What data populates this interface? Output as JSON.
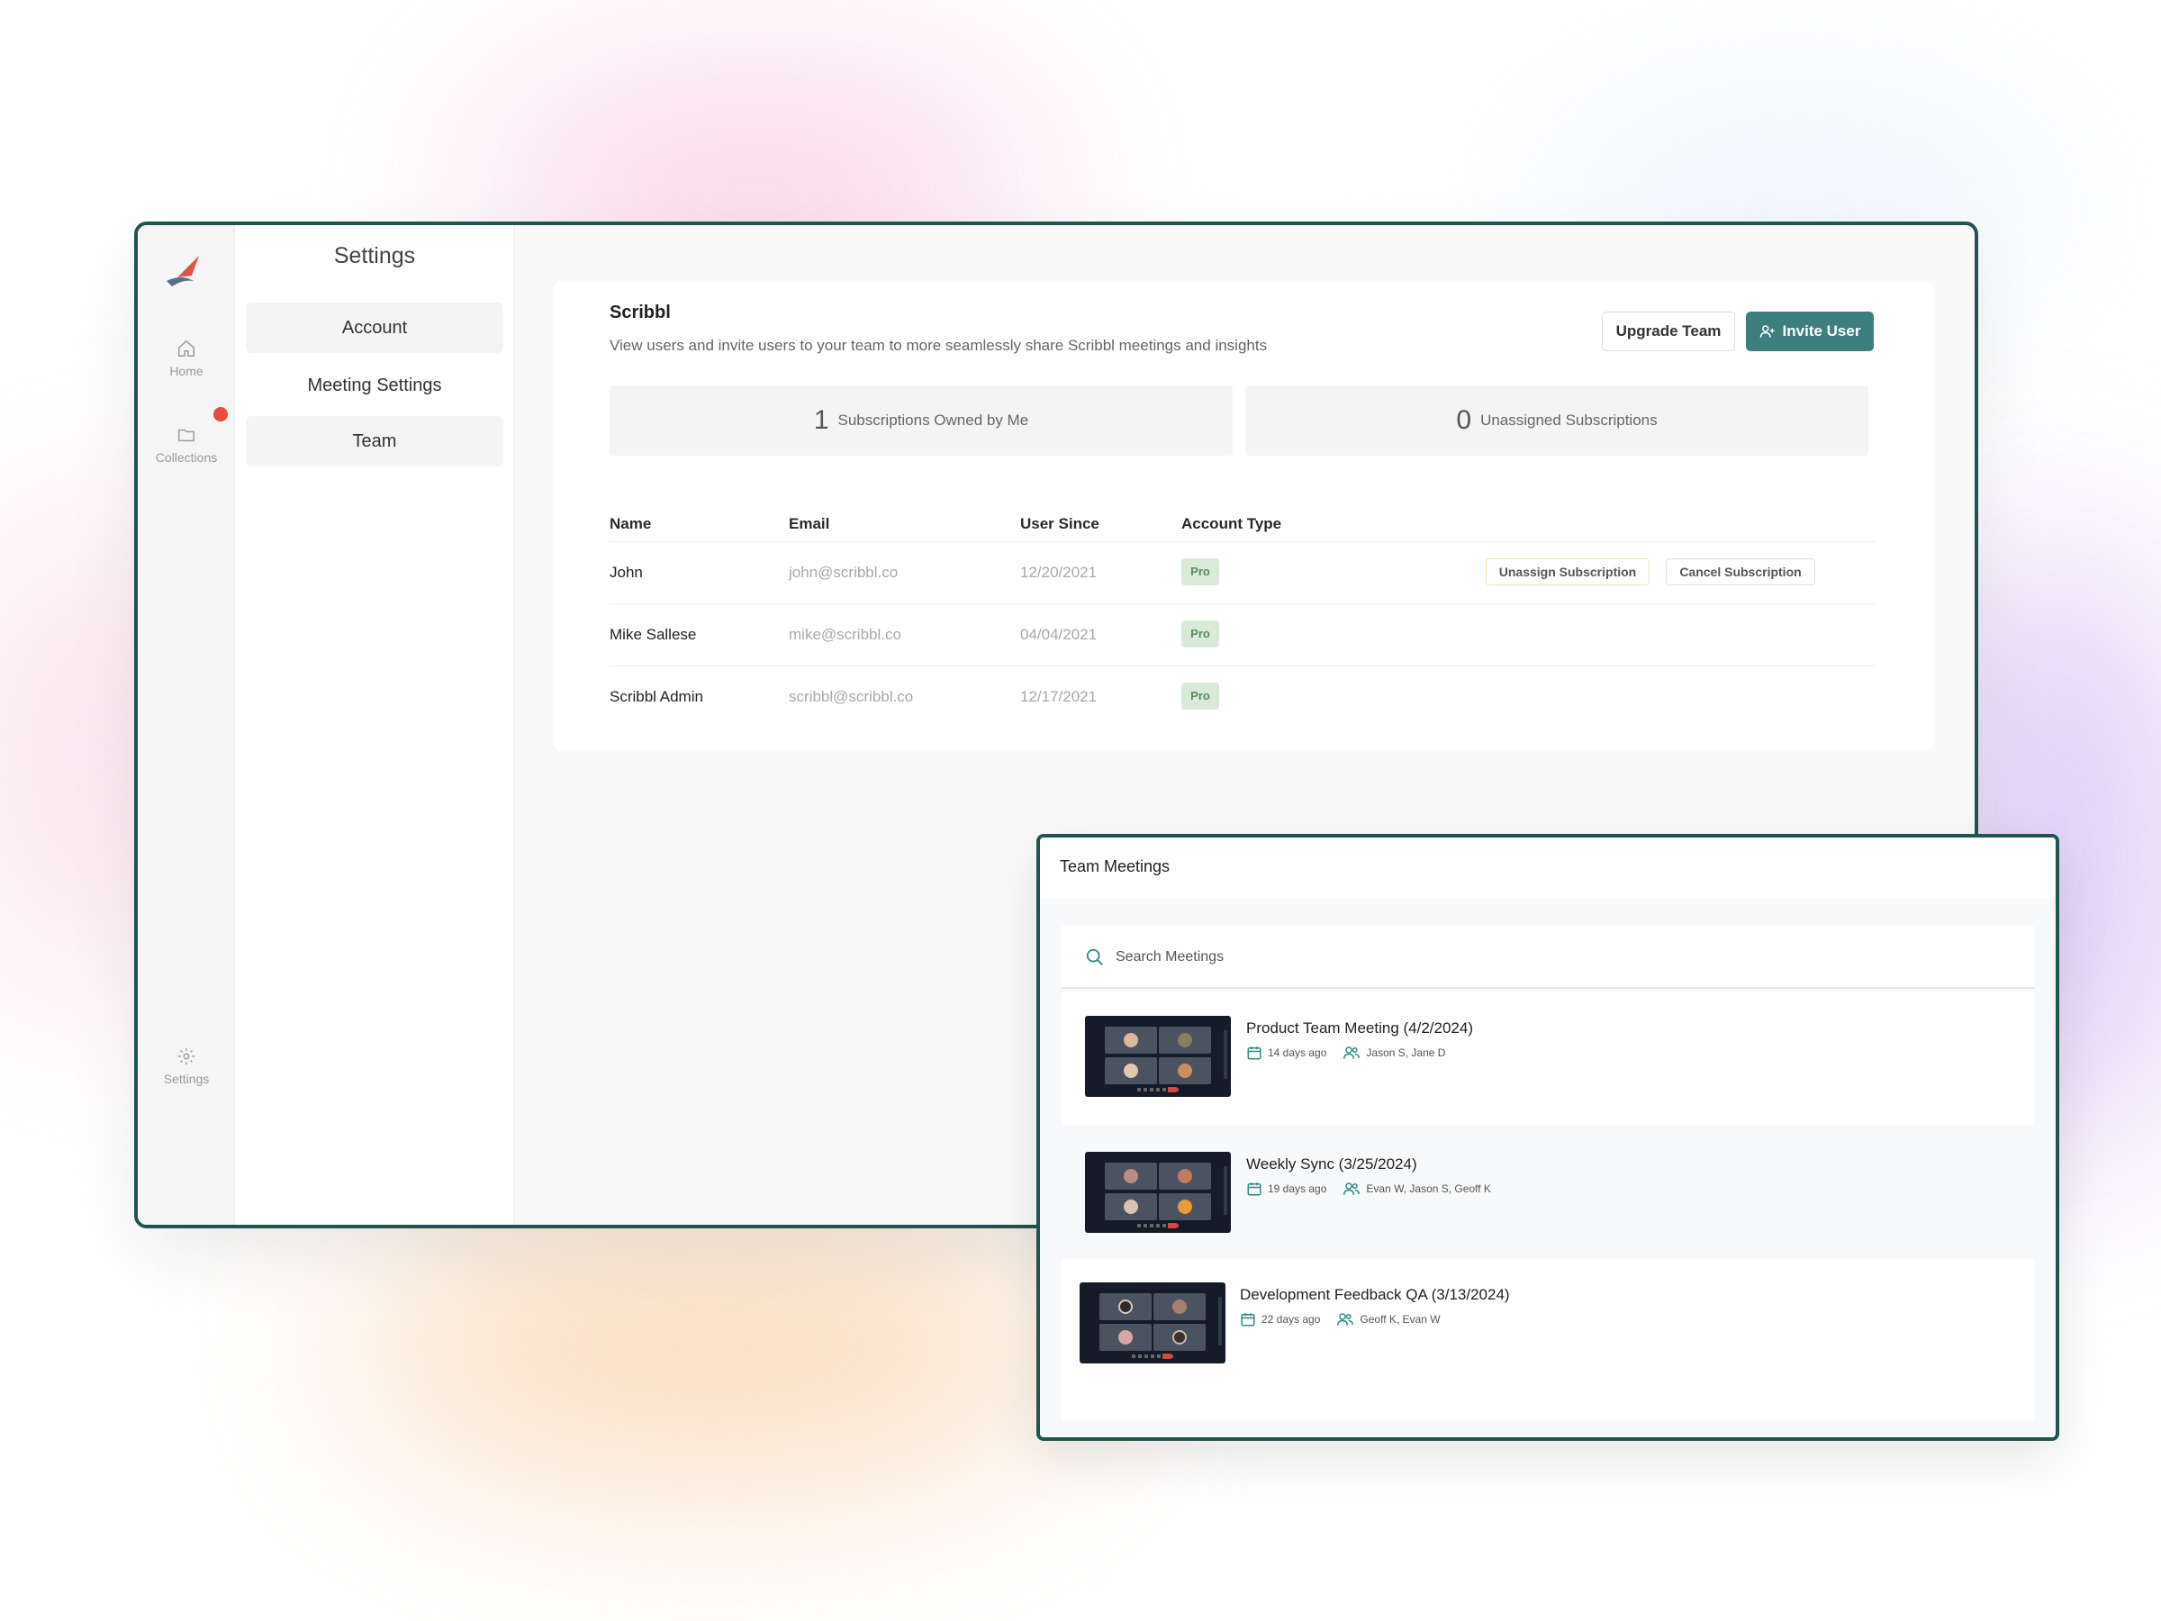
{
  "sidebar": {
    "items": [
      {
        "label": "Home",
        "icon": "home-icon"
      },
      {
        "label": "Collections",
        "icon": "folder-icon"
      },
      {
        "label": "Settings",
        "icon": "gear-icon"
      }
    ],
    "notification_color": "#e74c3c"
  },
  "settings_nav": {
    "title": "Settings",
    "items": [
      {
        "label": "Account"
      },
      {
        "label": "Meeting Settings"
      },
      {
        "label": "Team"
      }
    ]
  },
  "team": {
    "title": "Scribbl",
    "subtitle": "View users and invite users to your team to more seamlessly share Scribbl meetings and insights",
    "upgrade_label": "Upgrade Team",
    "invite_label": "Invite User",
    "stats": [
      {
        "count": "1",
        "label": "Subscriptions Owned by Me"
      },
      {
        "count": "0",
        "label": "Unassigned Subscriptions"
      }
    ],
    "columns": [
      "Name",
      "Email",
      "User Since",
      "Account Type"
    ],
    "rows": [
      {
        "name": "John",
        "email": "john@scribbl.co",
        "since": "12/20/2021",
        "type": "Pro"
      },
      {
        "name": "Mike Sallese",
        "email": "mike@scribbl.co",
        "since": "04/04/2021",
        "type": "Pro"
      },
      {
        "name": "Scribbl Admin",
        "email": "scribbl@scribbl.co",
        "since": "12/17/2021",
        "type": "Pro"
      }
    ],
    "row_actions": {
      "unassign_label": "Unassign Subscription",
      "cancel_label": "Cancel Subscription"
    },
    "accent_color": "#3c7f7d"
  },
  "team_meetings": {
    "title": "Team Meetings",
    "search_placeholder": "Search Meetings",
    "meetings": [
      {
        "title": "Product Team Meeting (4/2/2024)",
        "ago": "14 days ago",
        "participants": "Jason S, Jane D"
      },
      {
        "title": "Weekly Sync (3/25/2024)",
        "ago": "19 days ago",
        "participants": "Evan W, Jason S, Geoff K"
      },
      {
        "title": "Development Feedback QA (3/13/2024)",
        "ago": "22 days ago",
        "participants": "Geoff K, Evan W"
      }
    ]
  }
}
